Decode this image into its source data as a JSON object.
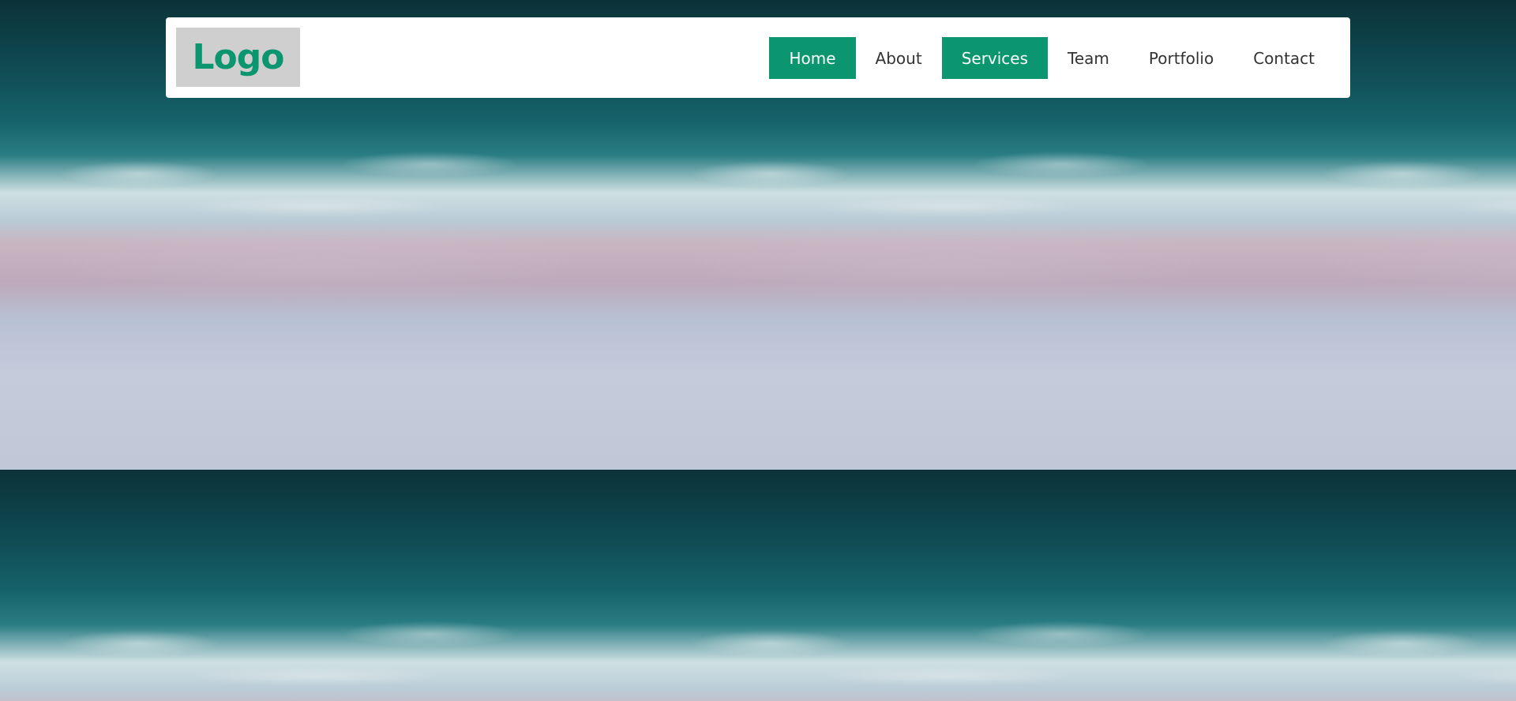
{
  "brand": {
    "logo_text": "Logo"
  },
  "nav": {
    "items": [
      {
        "label": "Home",
        "active": true
      },
      {
        "label": "About",
        "active": false
      },
      {
        "label": "Services",
        "active": true
      },
      {
        "label": "Team",
        "active": false
      },
      {
        "label": "Portfolio",
        "active": false
      },
      {
        "label": "Contact",
        "active": false
      }
    ]
  },
  "colors": {
    "accent": "#0b9670",
    "logo_bg": "#cfcfcf",
    "nav_text": "#333333",
    "header_bg": "#ffffff"
  }
}
